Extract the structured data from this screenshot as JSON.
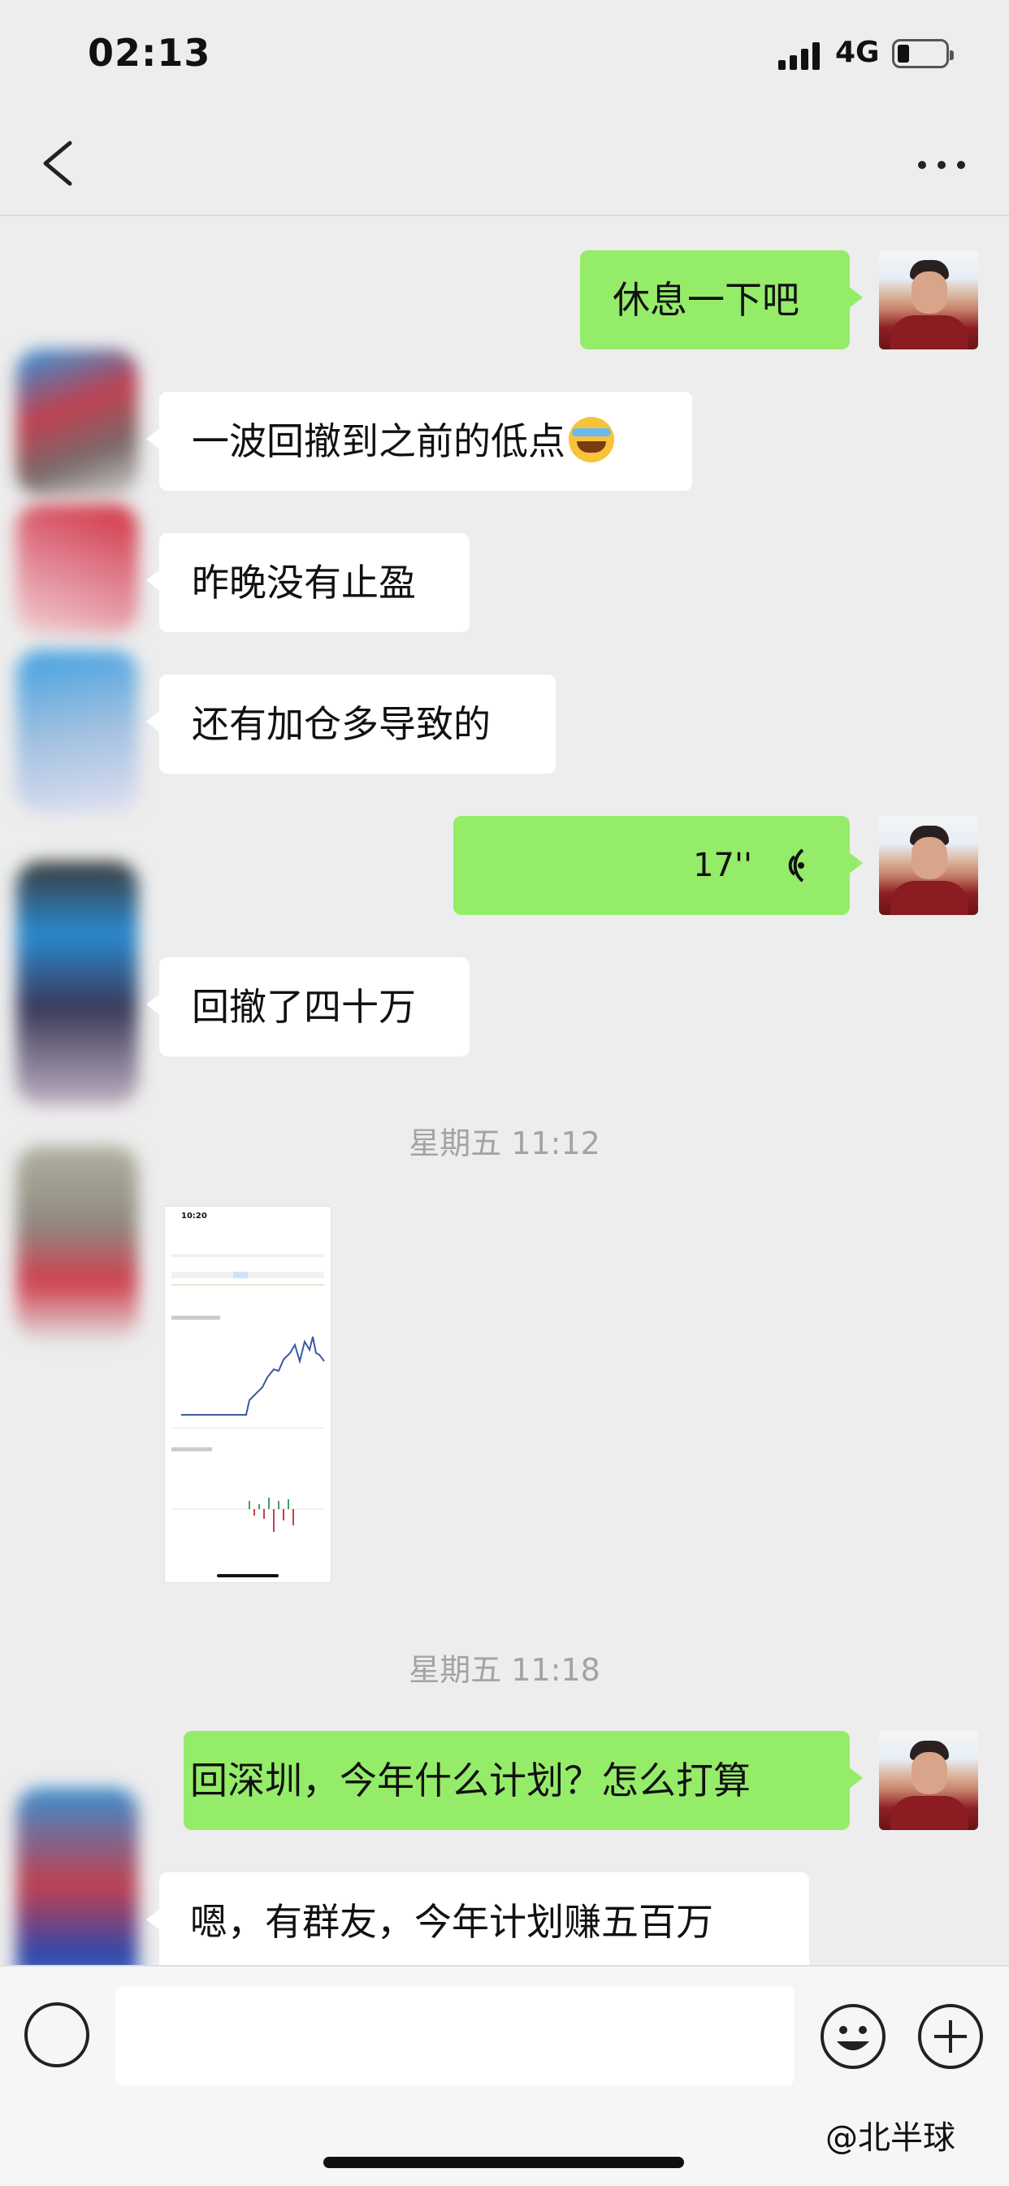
{
  "status_bar": {
    "time": "02:13",
    "network": "4G"
  },
  "messages": [
    {
      "side": "me",
      "text": "休息一下吧"
    },
    {
      "side": "other",
      "text": "一波回撤到之前的低点",
      "emoji": "face-holding-back-tears-emoji"
    },
    {
      "side": "other",
      "text": "昨晚没有止盈"
    },
    {
      "side": "other",
      "text": "还有加仓多导致的"
    },
    {
      "side": "me",
      "type": "voice",
      "duration": "17''"
    },
    {
      "side": "other",
      "text": "回撤了四十万"
    },
    {
      "type": "timestamp",
      "text": "星期五 11:12"
    },
    {
      "side": "other",
      "type": "image",
      "thumbnail_time": "10:20"
    },
    {
      "type": "timestamp",
      "text": "星期五 11:18"
    },
    {
      "side": "me",
      "text": "回深圳，今年什么计划？怎么打算"
    },
    {
      "side": "other",
      "text": "嗯，有群友，今年计划赚五百万"
    }
  ],
  "watermark": "@北半球",
  "icons": [
    "back-arrow-icon",
    "more-dots-icon",
    "voice-wave-icon",
    "voice-input-icon",
    "emoji-face-icon",
    "plus-circle-icon"
  ],
  "colors": {
    "me_bubble": "#95ec69",
    "other_bubble": "#ffffff",
    "background": "#ededed",
    "timestamp": "#a3a3a3"
  }
}
